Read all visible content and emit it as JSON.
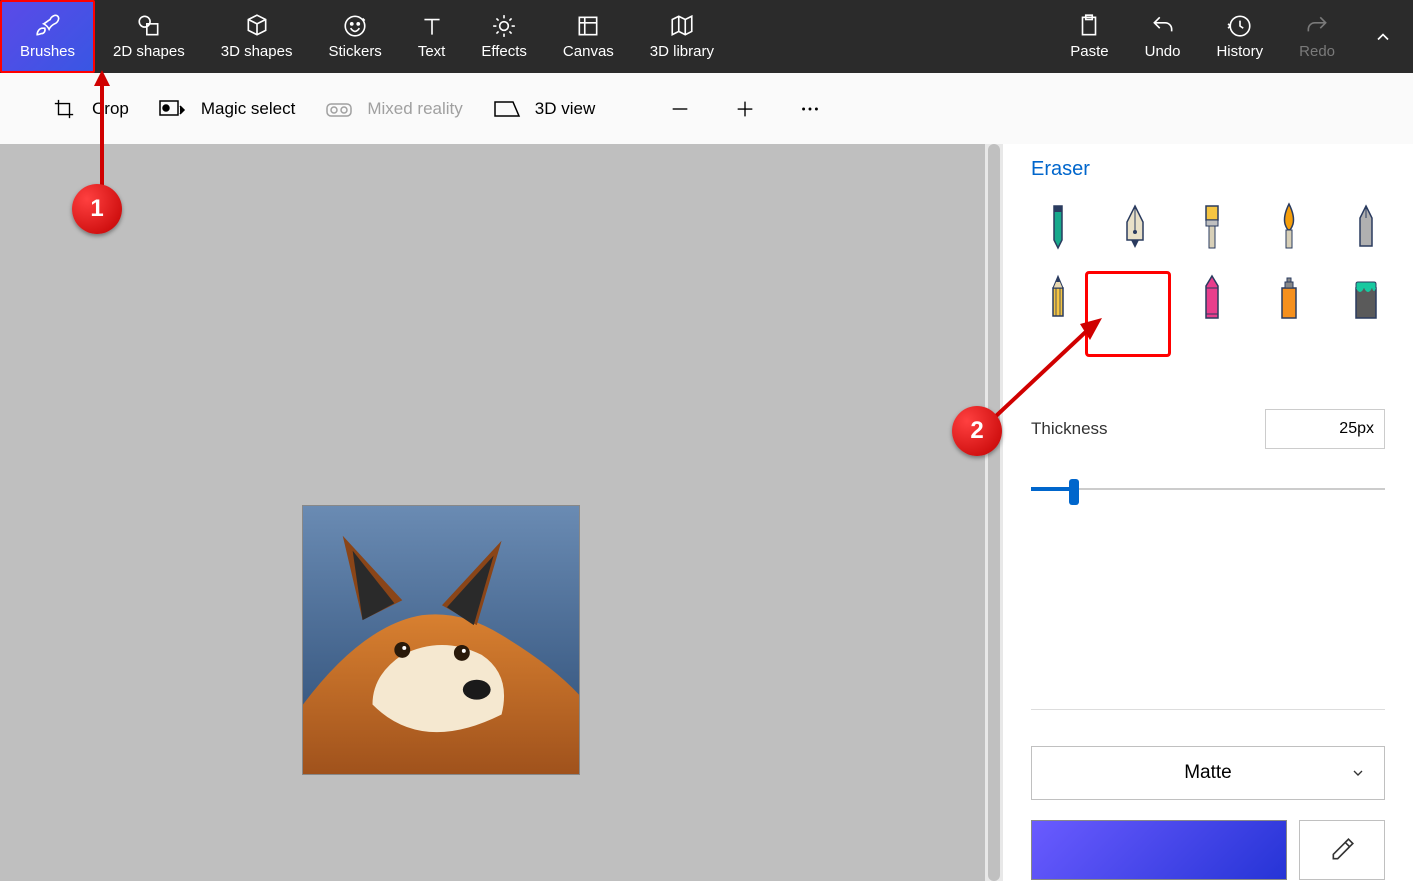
{
  "toolbar": {
    "brushes": "Brushes",
    "shapes2d": "2D shapes",
    "shapes3d": "3D shapes",
    "stickers": "Stickers",
    "text": "Text",
    "effects": "Effects",
    "canvas": "Canvas",
    "library3d": "3D library",
    "paste": "Paste",
    "undo": "Undo",
    "history": "History",
    "redo": "Redo"
  },
  "subbar": {
    "crop": "Crop",
    "magic_select": "Magic select",
    "mixed_reality": "Mixed reality",
    "view3d": "3D view"
  },
  "panel": {
    "title": "Eraser",
    "thickness_label": "Thickness",
    "thickness_value": "25px",
    "material": "Matte"
  },
  "annotations": {
    "one": "1",
    "two": "2"
  }
}
